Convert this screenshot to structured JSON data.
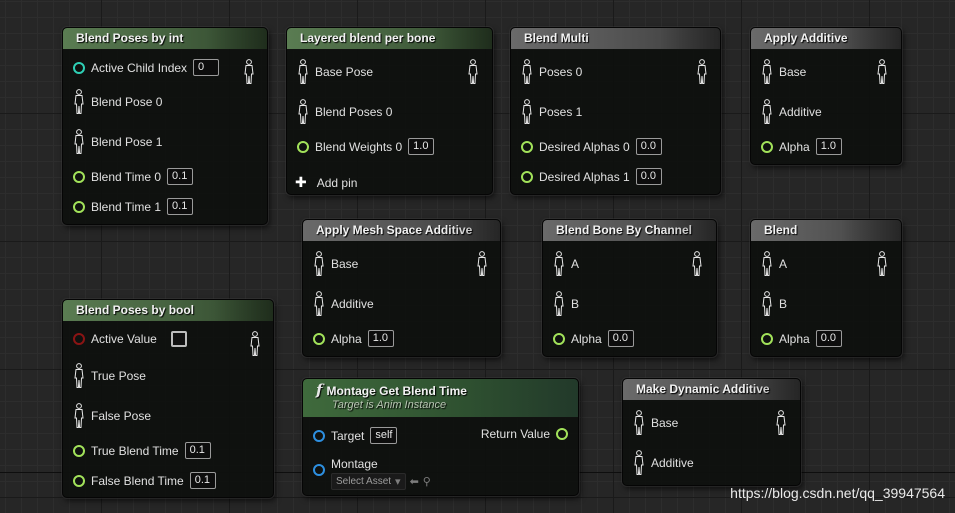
{
  "nodes": {
    "blend_int": {
      "title": "Blend Poses by int",
      "active_child_index": {
        "label": "Active Child Index",
        "value": "0"
      },
      "blend_pose_0": "Blend Pose 0",
      "blend_pose_1": "Blend Pose 1",
      "blend_time_0": {
        "label": "Blend Time 0",
        "value": "0.1"
      },
      "blend_time_1": {
        "label": "Blend Time 1",
        "value": "0.1"
      }
    },
    "layered": {
      "title": "Layered blend per bone",
      "base_pose": "Base Pose",
      "blend_poses_0": "Blend Poses 0",
      "blend_weights_0": {
        "label": "Blend Weights 0",
        "value": "1.0"
      },
      "add_pin": "Add pin"
    },
    "blend_multi": {
      "title": "Blend Multi",
      "poses_0": "Poses 0",
      "poses_1": "Poses 1",
      "desired_alphas_0": {
        "label": "Desired Alphas 0",
        "value": "0.0"
      },
      "desired_alphas_1": {
        "label": "Desired Alphas 1",
        "value": "0.0"
      }
    },
    "apply_additive": {
      "title": "Apply Additive",
      "base": "Base",
      "additive": "Additive",
      "alpha": {
        "label": "Alpha",
        "value": "1.0"
      }
    },
    "apply_mesh_space": {
      "title": "Apply Mesh Space Additive",
      "base": "Base",
      "additive": "Additive",
      "alpha": {
        "label": "Alpha",
        "value": "1.0"
      }
    },
    "blend_bone_channel": {
      "title": "Blend Bone By Channel",
      "a": "A",
      "b": "B",
      "alpha": {
        "label": "Alpha",
        "value": "0.0"
      }
    },
    "blend": {
      "title": "Blend",
      "a": "A",
      "b": "B",
      "alpha": {
        "label": "Alpha",
        "value": "0.0"
      }
    },
    "blend_bool": {
      "title": "Blend Poses by bool",
      "active_value": "Active Value",
      "true_pose": "True Pose",
      "false_pose": "False Pose",
      "true_blend_time": {
        "label": "True Blend Time",
        "value": "0.1"
      },
      "false_blend_time": {
        "label": "False Blend Time",
        "value": "0.1"
      }
    },
    "montage": {
      "title": "Montage Get Blend Time",
      "subtitle": "Target is Anim Instance",
      "target": {
        "label": "Target",
        "value": "self"
      },
      "return_value": "Return Value",
      "montage": "Montage",
      "select_asset": "Select Asset"
    },
    "make_dynamic": {
      "title": "Make Dynamic Additive",
      "base": "Base",
      "additive": "Additive"
    }
  },
  "watermark": "https://blog.csdn.net/qq_39947564",
  "colors": {
    "float_pin": "#a2e25a",
    "int_pin": "#2ecfb5",
    "bool_pin": "#8a1414",
    "object_pin": "#2d8fe0",
    "anim_node_title": "#4f6e48",
    "pure_node_title": "#5a5a5a"
  }
}
